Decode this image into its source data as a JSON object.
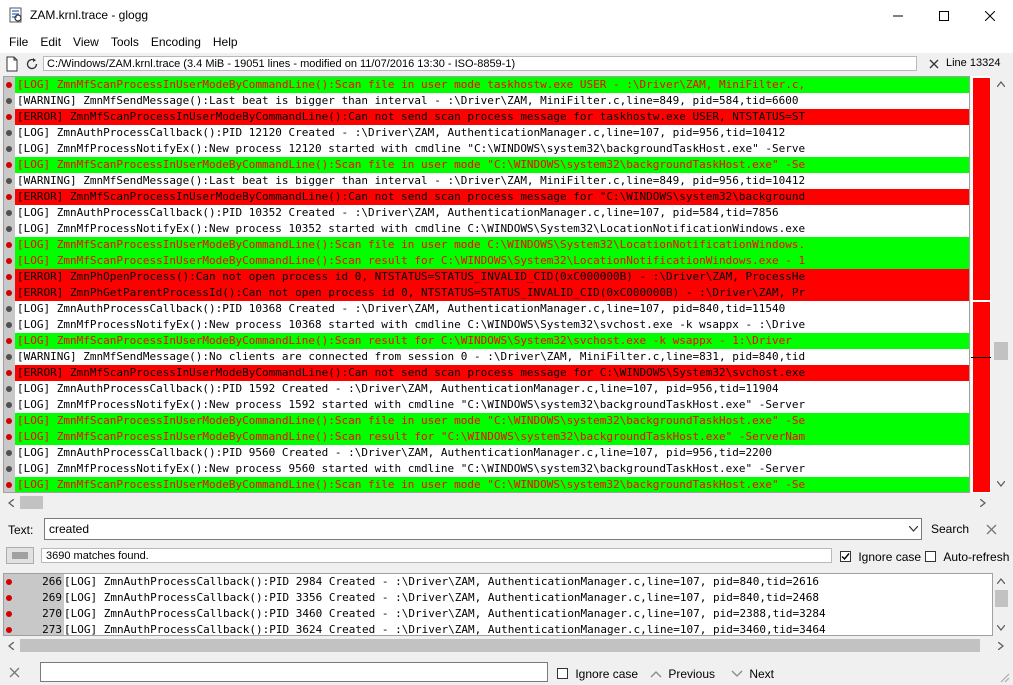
{
  "window": {
    "title": "ZAM.krnl.trace - glogg"
  },
  "menu": [
    "File",
    "Edit",
    "View",
    "Tools",
    "Encoding",
    "Help"
  ],
  "infobar": {
    "file_info": "C:/Windows/ZAM.krnl.trace (3.4 MiB - 19051 lines - modified on 11/07/2016 13:30 - ISO-8859-1)",
    "line_label": "Line 13324"
  },
  "colors": {
    "green": "#00ff00",
    "red": "#ff0000",
    "white": "#ffffff",
    "green_text": "#ff0000",
    "red_text": "#000000",
    "overview_red": "#ff0000"
  },
  "log_lines": [
    {
      "type": "green",
      "text": "[LOG] ZmnMfScanProcessInUserModeByCommandLine():Scan file in user mode taskhostw.exe USER - :\\Driver\\ZAM, MiniFilter.c,"
    },
    {
      "type": "white",
      "text": "[WARNING] ZmnMfSendMessage():Last beat is bigger than interval - :\\Driver\\ZAM, MiniFilter.c,line=849, pid=584,tid=6600"
    },
    {
      "type": "red",
      "text": "[ERROR] ZmnMfScanProcessInUserModeByCommandLine():Can not send scan process message for taskhostw.exe USER, NTSTATUS=ST"
    },
    {
      "type": "white",
      "text": "[LOG] ZmnAuthProcessCallback():PID 12120 Created - :\\Driver\\ZAM, AuthenticationManager.c,line=107, pid=956,tid=10412"
    },
    {
      "type": "white",
      "text": "[LOG] ZmnMfProcessNotifyEx():New process 12120 started with cmdline \"C:\\WINDOWS\\system32\\backgroundTaskHost.exe\" -Serve"
    },
    {
      "type": "green",
      "text": "[LOG] ZmnMfScanProcessInUserModeByCommandLine():Scan file in user mode \"C:\\WINDOWS\\system32\\backgroundTaskHost.exe\" -Se"
    },
    {
      "type": "white",
      "text": "[WARNING] ZmnMfSendMessage():Last beat is bigger than interval - :\\Driver\\ZAM, MiniFilter.c,line=849, pid=956,tid=10412"
    },
    {
      "type": "red",
      "text": "[ERROR] ZmnMfScanProcessInUserModeByCommandLine():Can not send scan process message for \"C:\\WINDOWS\\system32\\background"
    },
    {
      "type": "white",
      "text": "[LOG] ZmnAuthProcessCallback():PID 10352 Created - :\\Driver\\ZAM, AuthenticationManager.c,line=107, pid=584,tid=7856"
    },
    {
      "type": "white",
      "text": "[LOG] ZmnMfProcessNotifyEx():New process 10352 started with cmdline C:\\WINDOWS\\System32\\LocationNotificationWindows.exe"
    },
    {
      "type": "green",
      "text": "[LOG] ZmnMfScanProcessInUserModeByCommandLine():Scan file in user mode C:\\WINDOWS\\System32\\LocationNotificationWindows."
    },
    {
      "type": "green",
      "text": "[LOG] ZmnMfScanProcessInUserModeByCommandLine():Scan result for C:\\WINDOWS\\System32\\LocationNotificationWindows.exe - 1"
    },
    {
      "type": "red",
      "text": "[ERROR] ZmnPhOpenProcess():Can not open process id 0, NTSTATUS=STATUS_INVALID_CID(0xC000000B) - :\\Driver\\ZAM, ProcessHe"
    },
    {
      "type": "red",
      "text": "[ERROR] ZmnPhGetParentProcessId():Can not open process id 0, NTSTATUS=STATUS_INVALID_CID(0xC000000B) - :\\Driver\\ZAM, Pr"
    },
    {
      "type": "white",
      "text": "[LOG] ZmnAuthProcessCallback():PID 10368 Created - :\\Driver\\ZAM, AuthenticationManager.c,line=107, pid=840,tid=11540"
    },
    {
      "type": "white",
      "text": "[LOG] ZmnMfProcessNotifyEx():New process 10368 started with cmdline C:\\WINDOWS\\System32\\svchost.exe -k wsappx - :\\Drive"
    },
    {
      "type": "green",
      "text": "[LOG] ZmnMfScanProcessInUserModeByCommandLine():Scan result for C:\\WINDOWS\\System32\\svchost.exe -k wsappx - 1:\\Driver"
    },
    {
      "type": "white",
      "text": "[WARNING] ZmnMfSendMessage():No clients are connected from session 0 - :\\Driver\\ZAM, MiniFilter.c,line=831, pid=840,tid"
    },
    {
      "type": "red",
      "text": "[ERROR] ZmnMfScanProcessInUserModeByCommandLine():Can not send scan process message for C:\\WINDOWS\\System32\\svchost.exe"
    },
    {
      "type": "white",
      "text": "[LOG] ZmnAuthProcessCallback():PID 1592 Created - :\\Driver\\ZAM, AuthenticationManager.c,line=107, pid=956,tid=11904"
    },
    {
      "type": "white",
      "text": "[LOG] ZmnMfProcessNotifyEx():New process 1592 started with cmdline \"C:\\WINDOWS\\system32\\backgroundTaskHost.exe\" -Server"
    },
    {
      "type": "green",
      "text": "[LOG] ZmnMfScanProcessInUserModeByCommandLine():Scan file in user mode \"C:\\WINDOWS\\system32\\backgroundTaskHost.exe\" -Se"
    },
    {
      "type": "green",
      "text": "[LOG] ZmnMfScanProcessInUserModeByCommandLine():Scan result for \"C:\\WINDOWS\\system32\\backgroundTaskHost.exe\" -ServerNam"
    },
    {
      "type": "white",
      "text": "[LOG] ZmnAuthProcessCallback():PID 9560 Created - :\\Driver\\ZAM, AuthenticationManager.c,line=107, pid=956,tid=2200"
    },
    {
      "type": "white",
      "text": "[LOG] ZmnMfProcessNotifyEx():New process 9560 started with cmdline \"C:\\WINDOWS\\system32\\backgroundTaskHost.exe\" -Server"
    },
    {
      "type": "green",
      "text": "[LOG] ZmnMfScanProcessInUserModeByCommandLine():Scan file in user mode \"C:\\WINDOWS\\system32\\backgroundTaskHost.exe\" -Se"
    }
  ],
  "search": {
    "label": "Text:",
    "value": "created",
    "button": "Search",
    "status": "3690 matches found.",
    "ignore_case_label": "Ignore case",
    "ignore_case_checked": true,
    "auto_refresh_label": "Auto-refresh",
    "auto_refresh_checked": false
  },
  "filtered_lines": [
    {
      "num": "266",
      "text": "[LOG] ZmnAuthProcessCallback():PID 2984 Created - :\\Driver\\ZAM, AuthenticationManager.c,line=107, pid=840,tid=2616"
    },
    {
      "num": "269",
      "text": "[LOG] ZmnAuthProcessCallback():PID 3356 Created - :\\Driver\\ZAM, AuthenticationManager.c,line=107, pid=840,tid=2468"
    },
    {
      "num": "270",
      "text": "[LOG] ZmnAuthProcessCallback():PID 3460 Created - :\\Driver\\ZAM, AuthenticationManager.c,line=107, pid=2388,tid=3284"
    },
    {
      "num": "273",
      "text": "[LOG] ZmnAuthProcessCallback():PID 3624 Created - :\\Driver\\ZAM, AuthenticationManager.c,line=107, pid=3460,tid=3464"
    }
  ],
  "findbar": {
    "ignore_case_label": "Ignore case",
    "previous_label": "Previous",
    "next_label": "Next"
  }
}
